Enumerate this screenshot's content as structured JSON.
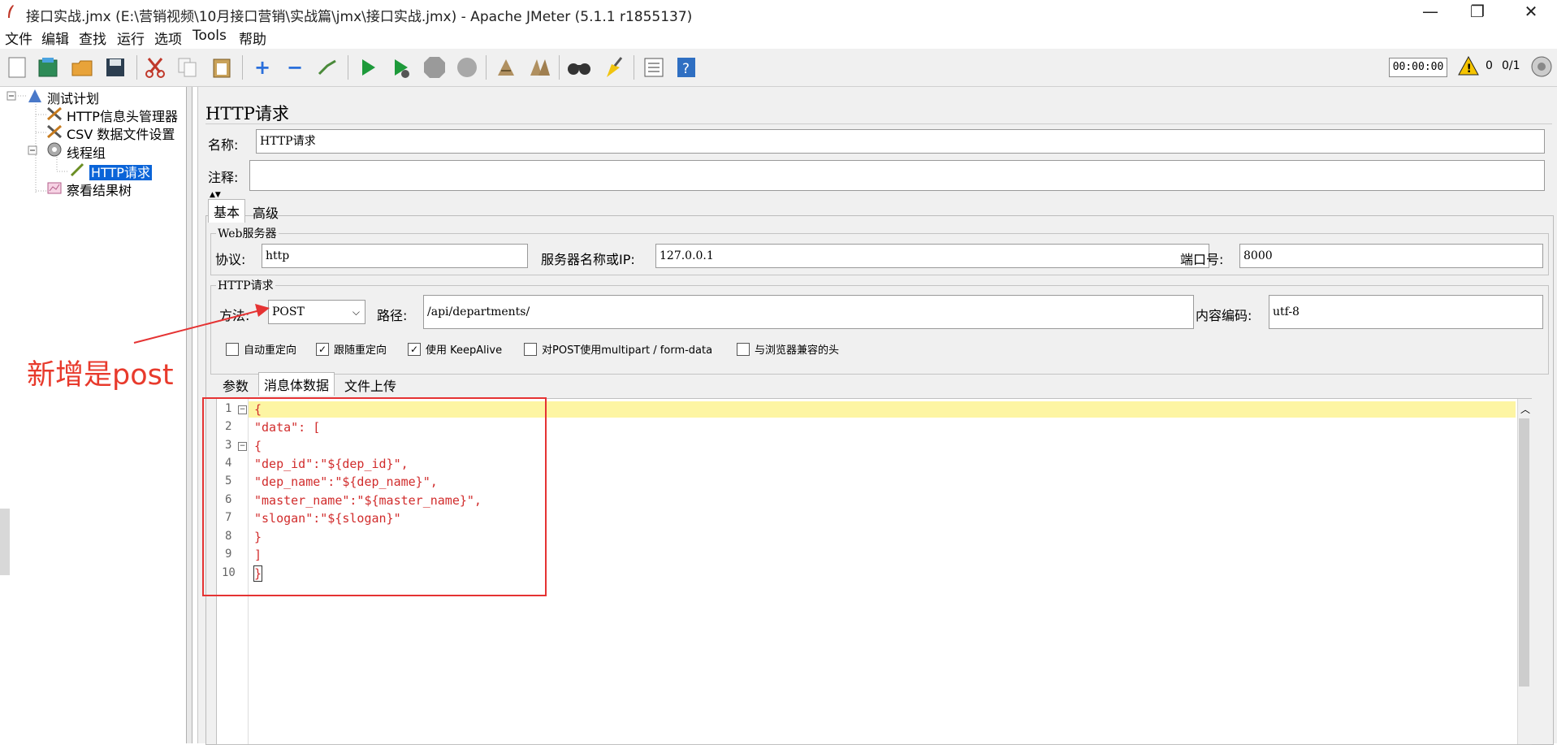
{
  "window": {
    "title": "接口实战.jmx (E:\\营销视频\\10月接口营销\\实战篇\\jmx\\接口实战.jmx) - Apache JMeter (5.1.1 r1855137)",
    "minimize": "—",
    "maximize": "❐",
    "close": "✕"
  },
  "menu": [
    "文件",
    "编辑",
    "查找",
    "运行",
    "选项",
    "Tools",
    "帮助"
  ],
  "toolbar": {
    "icons": [
      "new-icon",
      "templates-icon",
      "open-icon",
      "save-icon",
      "cut-icon",
      "copy-icon",
      "paste-icon",
      "expand-icon",
      "collapse-icon",
      "toggle-icon",
      "start-icon",
      "start-no-pause-icon",
      "stop-icon",
      "shutdown-icon",
      "clear-icon",
      "clear-all-icon",
      "search-icon",
      "reset-search-icon",
      "function-helper-icon",
      "help-icon"
    ],
    "timer": "00:00:00",
    "warning_count": "0",
    "threads": "0/1"
  },
  "tree": {
    "items": [
      {
        "label": "测试计划",
        "icon": "test-plan-icon"
      },
      {
        "label": "HTTP信息头管理器",
        "icon": "config-element-icon"
      },
      {
        "label": "CSV 数据文件设置",
        "icon": "config-element-icon"
      },
      {
        "label": "线程组",
        "icon": "thread-group-icon"
      },
      {
        "label": "HTTP请求",
        "icon": "sampler-icon"
      },
      {
        "label": "察看结果树",
        "icon": "listener-icon"
      }
    ]
  },
  "panel": {
    "header": "HTTP请求",
    "name_label": "名称:",
    "name_value": "HTTP请求",
    "comment_label": "注释:",
    "comment_value": "",
    "tabs": [
      "基本",
      "高级"
    ],
    "web_server": {
      "title": "Web服务器",
      "protocol_label": "协议:",
      "protocol_value": "http",
      "server_label": "服务器名称或IP:",
      "server_value": "127.0.0.1",
      "port_label": "端口号:",
      "port_value": "8000"
    },
    "http_request": {
      "title": "HTTP请求",
      "method_label": "方法:",
      "method_value": "POST",
      "path_label": "路径:",
      "path_value": "/api/departments/",
      "encoding_label": "内容编码:",
      "encoding_value": "utf-8"
    },
    "checkboxes": [
      {
        "label": "自动重定向",
        "checked": false
      },
      {
        "label": "跟随重定向",
        "checked": true
      },
      {
        "label": "使用 KeepAlive",
        "checked": true
      },
      {
        "label": "对POST使用multipart / form-data",
        "checked": false
      },
      {
        "label": "与浏览器兼容的头",
        "checked": false
      }
    ],
    "sub_tabs": [
      "参数",
      "消息体数据",
      "文件上传"
    ]
  },
  "editor": {
    "lines": [
      "{",
      "\"data\": [",
      "{",
      "\"dep_id\":\"${dep_id}\",",
      "\"dep_name\":\"${dep_name}\",",
      "\"master_name\":\"${master_name}\",",
      "\"slogan\":\"${slogan}\"",
      "}",
      "]",
      "}"
    ],
    "line_numbers": [
      "1",
      "2",
      "3",
      "4",
      "5",
      "6",
      "7",
      "8",
      "9",
      "10"
    ]
  },
  "annotation": {
    "text": "新增是post",
    "color": "#e83a2c"
  }
}
